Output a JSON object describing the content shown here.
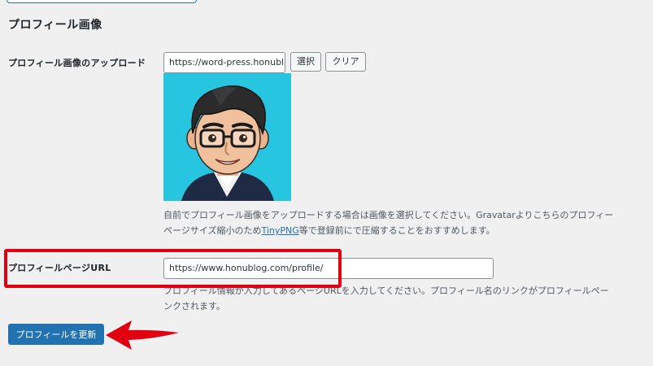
{
  "section": {
    "title": "プロフィール画像"
  },
  "upload": {
    "label": "プロフィール画像のアップロード",
    "url_value": "https://word-press.honubl",
    "select_button": "選択",
    "clear_button": "クリア",
    "description_line1": "自前でプロフィール画像をアップロードする場合は画像を選択してください。Gravatarよりこちらのプロフィー",
    "description_line2_before": "ページサイズ縮小のため",
    "description_link": "TinyPNG",
    "description_line2_after": "等で登録前にで圧縮することをおすすめします。"
  },
  "profile_page": {
    "label": "プロフィールページURL",
    "url_value": "https://www.honublog.com/profile/",
    "description_line1": "プロフィール情報が入力してあるページURLを入力してください。プロフィール名のリンクがプロフィールペー",
    "description_line2": "ンクされます。"
  },
  "actions": {
    "update_button": "プロフィールを更新"
  },
  "colors": {
    "accent": "#2271b1",
    "highlight": "#e00012",
    "avatar_background": "#27c5df"
  }
}
